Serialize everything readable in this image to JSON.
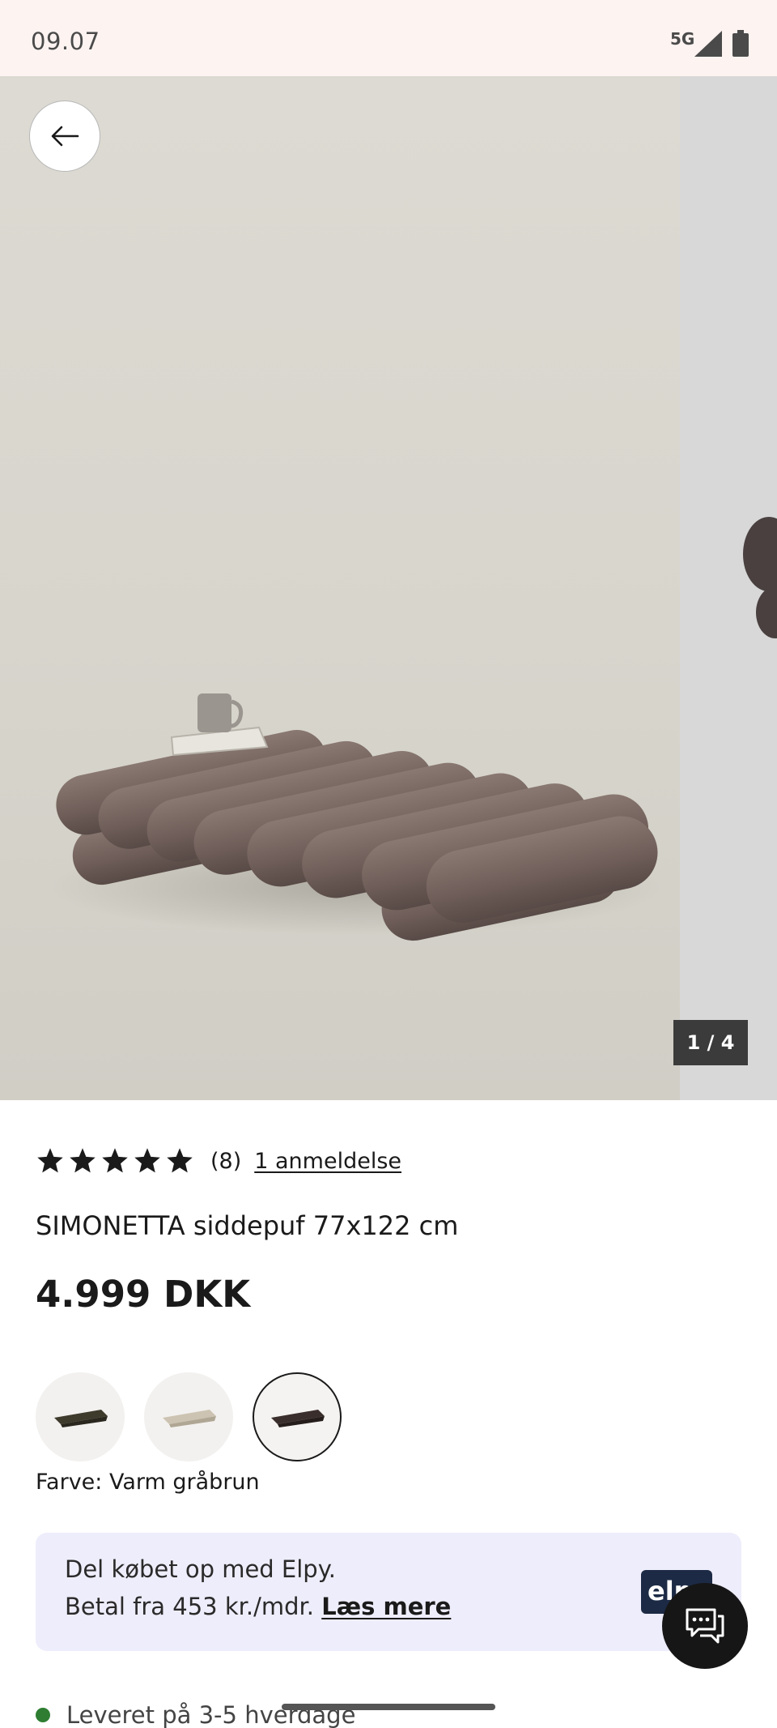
{
  "status_bar": {
    "time": "09.07",
    "network": "5G",
    "icons": [
      "signal-icon",
      "battery-icon"
    ]
  },
  "gallery": {
    "counter": "1 / 4",
    "back_icon": "arrow-left-icon"
  },
  "product": {
    "rating_stars": 5,
    "rating_count": "(8)",
    "reviews_link": "1 anmeldelse",
    "title": "SIMONETTA siddepuf 77x122 cm",
    "price": "4.999 DKK",
    "color_label": "Farve: Varm gråbrun",
    "swatches": [
      {
        "name": "swatch-dark-olive",
        "color": "#3e3a2c",
        "selected": false
      },
      {
        "name": "swatch-cream",
        "color": "#cdc3b2",
        "selected": false
      },
      {
        "name": "swatch-warm-grey-brown",
        "color": "#3a2e2c",
        "selected": true
      }
    ]
  },
  "elpy": {
    "line1": "Del købet op med Elpy.",
    "line2": "Betal fra 453 kr./mdr.",
    "link": "Læs mere",
    "logo_text": "elpy"
  },
  "delivery": {
    "text": "Leveret på 3-5 hverdage",
    "status_color": "#2e7d32"
  },
  "colors": {
    "status_bar_bg": "#fdf3f1",
    "elpy_bg": "#eeedfb",
    "elpy_logo_bg": "#1c2a45",
    "chat_button_bg": "#161616"
  }
}
